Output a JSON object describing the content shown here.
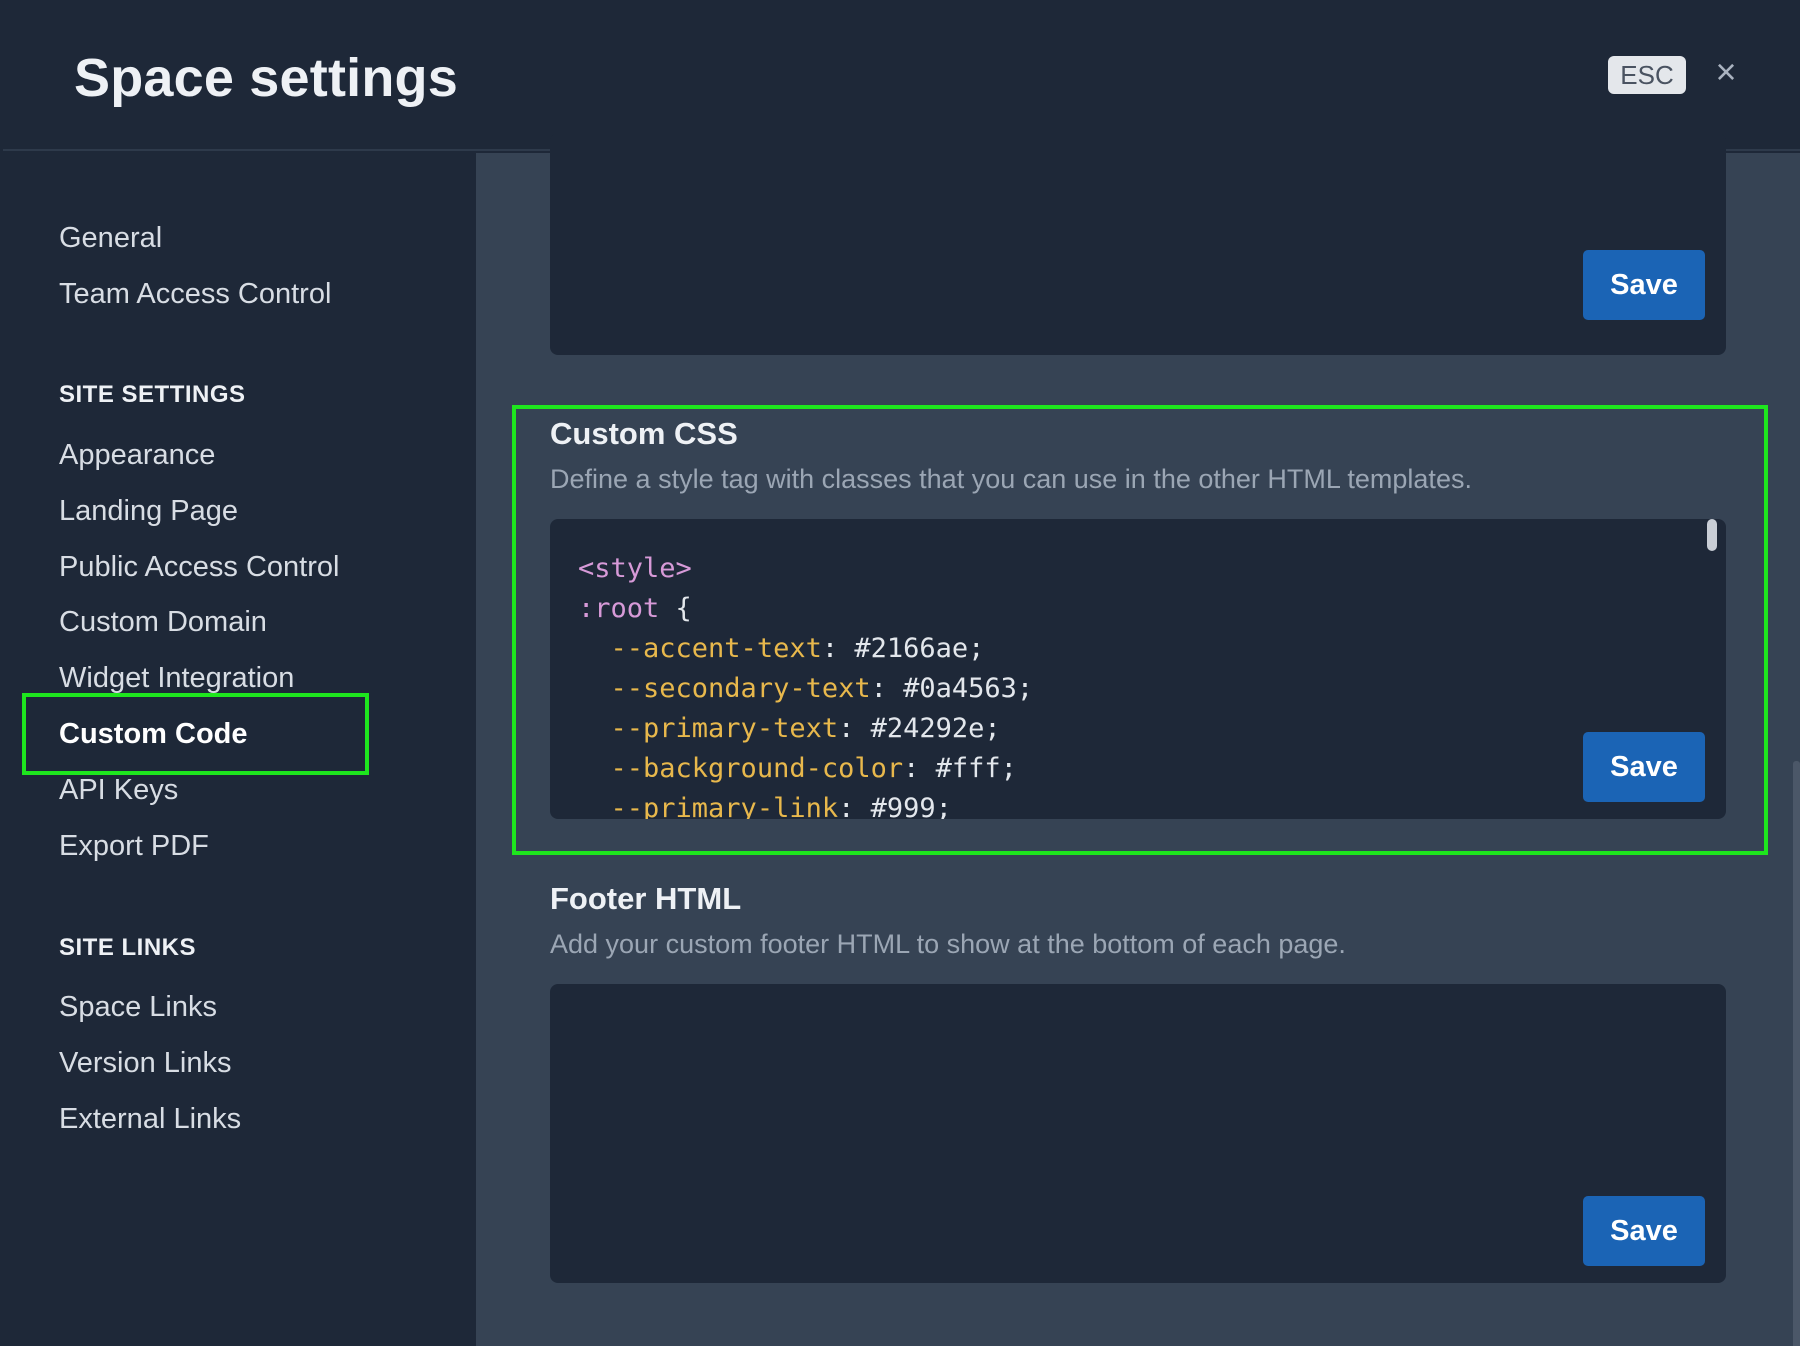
{
  "header": {
    "title": "Space settings",
    "esc_label": "ESC",
    "close_glyph": "×"
  },
  "sidebar": {
    "top_items": [
      "General",
      "Team Access Control"
    ],
    "site_settings_heading": "SITE SETTINGS",
    "site_settings_items": [
      "Appearance",
      "Landing Page",
      "Public Access Control",
      "Custom Domain",
      "Widget Integration",
      "Custom Code",
      "API Keys",
      "Export PDF"
    ],
    "active_item": "Custom Code",
    "site_links_heading": "SITE LINKS",
    "site_links_items": [
      "Space Links",
      "Version Links",
      "External Links"
    ]
  },
  "main": {
    "top_panel": {
      "save_label": "Save"
    },
    "custom_css": {
      "title": "Custom CSS",
      "description": "Define a style tag with classes that you can use in the other HTML templates.",
      "save_label": "Save",
      "code": {
        "open_tag": "<style>",
        "selector": ":root",
        "brace": " {",
        "lines": [
          {
            "prop": "--accent-text",
            "value": "#2166ae"
          },
          {
            "prop": "--secondary-text",
            "value": "#0a4563"
          },
          {
            "prop": "--primary-text",
            "value": "#24292e"
          },
          {
            "prop": "--background-color",
            "value": "#fff"
          },
          {
            "prop": "--primary-link",
            "value": "#999"
          }
        ]
      }
    },
    "footer_html": {
      "title": "Footer HTML",
      "description": "Add your custom footer HTML to show at the bottom of each page.",
      "save_label": "Save"
    }
  },
  "colors": {
    "accent_button": "#1b64b5",
    "highlight": "#1ee61e",
    "background": "#1e2838",
    "panel": "#364354"
  }
}
